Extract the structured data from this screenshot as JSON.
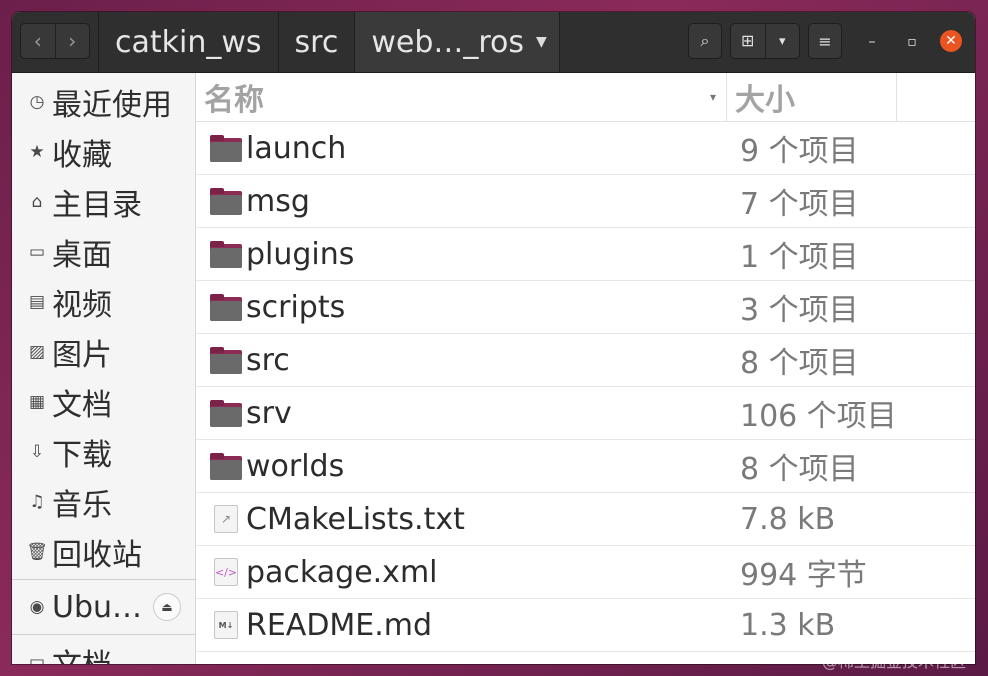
{
  "header": {
    "breadcrumbs": [
      "catkin_ws",
      "src",
      "web…_ros"
    ],
    "nav_back": "‹",
    "nav_forward": "›",
    "search_icon": "⌕",
    "view_icon": "⊞",
    "view_caret": "▾",
    "menu_icon": "≡",
    "minimize": "–",
    "maximize": "▫",
    "close": "✕"
  },
  "sidebar": {
    "items": [
      {
        "label": "最近使用",
        "icon": "◷"
      },
      {
        "label": "收藏",
        "icon": "★"
      },
      {
        "label": "主目录",
        "icon": "⌂"
      },
      {
        "label": "桌面",
        "icon": "▭"
      },
      {
        "label": "视频",
        "icon": "▤"
      },
      {
        "label": "图片",
        "icon": "▨"
      },
      {
        "label": "文档",
        "icon": "▦"
      },
      {
        "label": "下载",
        "icon": "⇩"
      },
      {
        "label": "音乐",
        "icon": "♫"
      },
      {
        "label": "回收站",
        "icon": "🗑"
      }
    ],
    "device": {
      "label": "Ubu…",
      "icon": "◉",
      "eject_icon": "⏏"
    },
    "bookmark": {
      "label": "文档",
      "icon": "▭"
    }
  },
  "columns": {
    "name": "名称",
    "size": "大小",
    "sort_icon": "▾"
  },
  "files": [
    {
      "name": "launch",
      "size": "9 个项目",
      "type": "folder"
    },
    {
      "name": "msg",
      "size": "7 个项目",
      "type": "folder"
    },
    {
      "name": "plugins",
      "size": "1 个项目",
      "type": "folder"
    },
    {
      "name": "scripts",
      "size": "3 个项目",
      "type": "folder"
    },
    {
      "name": "src",
      "size": "8 个项目",
      "type": "folder"
    },
    {
      "name": "srv",
      "size": "106 个项目",
      "type": "folder"
    },
    {
      "name": "worlds",
      "size": "8 个项目",
      "type": "folder"
    },
    {
      "name": "CMakeLists.txt",
      "size": "7.8 kB",
      "type": "text",
      "glyph": "↗"
    },
    {
      "name": "package.xml",
      "size": "994 字节",
      "type": "xml",
      "glyph": "</>"
    },
    {
      "name": "README.md",
      "size": "1.3 kB",
      "type": "md",
      "glyph": "M↓"
    }
  ],
  "watermark": "@稀土掘金技术社区"
}
